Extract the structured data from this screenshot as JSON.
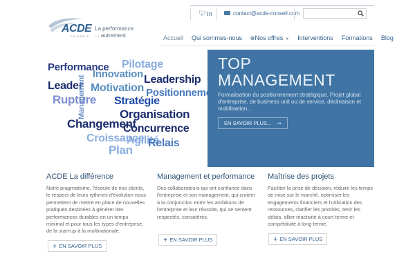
{
  "brand": {
    "logo_text": "ACDE",
    "logo_subtext": "CONSEIL",
    "tagline_line1": "La performance",
    "tagline_line2": "... autrement"
  },
  "topbar": {
    "twitter_icon": "twitter-icon",
    "linkedin_icon": "linkedin-icon",
    "email": "contact@acde-conseil.com",
    "search_placeholder": ""
  },
  "nav": {
    "items": [
      {
        "label": "Accueil",
        "active": true
      },
      {
        "label": "Qui sommes-nous"
      },
      {
        "label": "Nos offres",
        "icon": "globe-icon",
        "dropdown": true
      },
      {
        "label": "Interventions"
      },
      {
        "label": "Formations"
      },
      {
        "label": "Blog"
      }
    ]
  },
  "word_cloud": {
    "words": [
      "Performance",
      "Innovation",
      "Pilotage",
      "Leadership",
      "Leader",
      "Motivation",
      "Positionnement",
      "Management",
      "Rupture",
      "Stratégie",
      "Organisation",
      "Changement",
      "Concurrence",
      "Croissance",
      "Agilité",
      "Relais",
      "Plan"
    ]
  },
  "hero": {
    "title_line1": "TOP",
    "title_line2": "MANAGEMENT",
    "text": "Formalisation du positionnement stratégique. Projet global d'entreprise, de business unit ou de service, déclinaison et mobilisation...",
    "button_label": "EN SAVOIR PLUS...",
    "button_icon": "arrow-right-icon"
  },
  "columns": [
    {
      "title": "ACDE La différence",
      "text": "Notre pragmatisme, l'écoute de nos clients, le respect de leurs rythmes d'évolution nous permettent de mettre en place de nouvelles pratiques destinées à générer des performances durables en un temps minimal et pour tous les types d'entreprise, de la start-up à la multinationale.",
      "button_label": "EN SAVOIR PLUS"
    },
    {
      "title": "Management et performance",
      "text": "Des collaborateurs qui ont confiance dans l'entreprise et son management, qui croient à la conjonction entre les ambitions de l'entreprise et leur réussite, qui se sentent respectés, considérés.",
      "button_label": "EN SAVOIR PLUS"
    },
    {
      "title": "Maîtrise des projets",
      "text": "Faciliter la prise de décision, réduire les temps de mise sur le marché, optimiser les engagements financiers et l'utilisation des ressources, clarifier les priorités, tenir les délais, allier réactivité à court terme et compétitivité à long terme.",
      "button_label": "EN SAVOIR PLUS"
    }
  ],
  "colors": {
    "hero_bg": "#3f74a4",
    "nav_text": "#2f5d88",
    "heading": "#2b4f72"
  }
}
